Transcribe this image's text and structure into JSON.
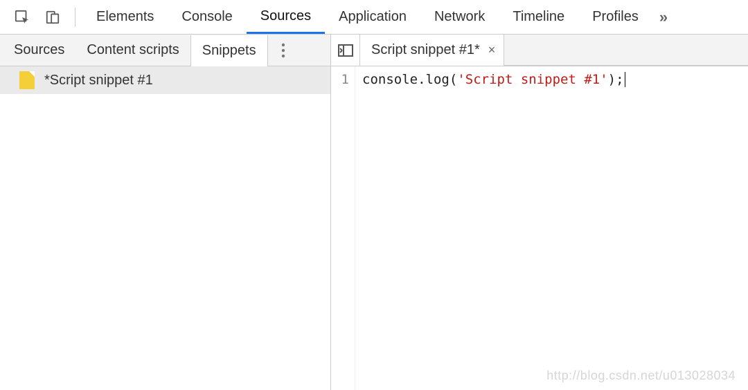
{
  "top_tabs": {
    "items": [
      {
        "label": "Elements"
      },
      {
        "label": "Console"
      },
      {
        "label": "Sources",
        "active": true
      },
      {
        "label": "Application"
      },
      {
        "label": "Network"
      },
      {
        "label": "Timeline"
      },
      {
        "label": "Profiles"
      }
    ],
    "overflow_glyph": "»"
  },
  "sub_tabs": {
    "items": [
      {
        "label": "Sources"
      },
      {
        "label": "Content scripts"
      },
      {
        "label": "Snippets",
        "active": true
      }
    ]
  },
  "file_tabs": {
    "items": [
      {
        "label": "Script snippet #1*",
        "close_glyph": "×"
      }
    ]
  },
  "sidebar": {
    "files": [
      {
        "label": "*Script snippet #1"
      }
    ]
  },
  "editor": {
    "line_number": "1",
    "code": {
      "seg1": "console",
      "seg2": ".",
      "seg3": "log",
      "seg4": "(",
      "seg5": "'Script snippet #1'",
      "seg6": ")",
      "seg7": ";"
    }
  },
  "watermark": "http://blog.csdn.net/u013028034"
}
